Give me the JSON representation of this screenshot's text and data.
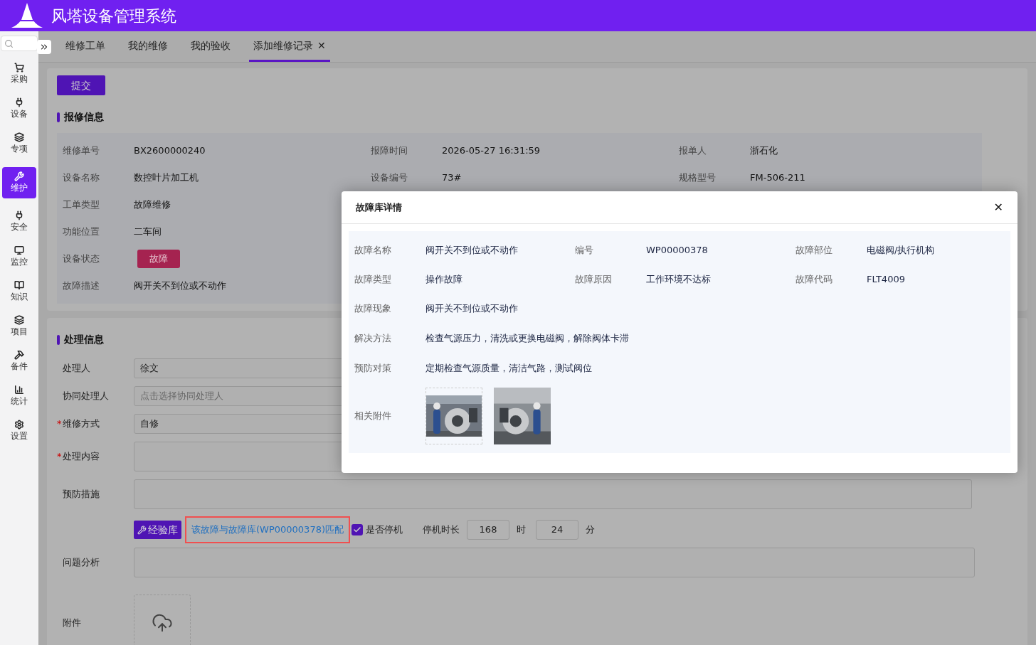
{
  "header": {
    "title": "风塔设备管理系统"
  },
  "tabs": [
    {
      "label": "维修工单",
      "selected": false
    },
    {
      "label": "我的维修",
      "selected": false
    },
    {
      "label": "我的验收",
      "selected": false
    },
    {
      "label": "添加维修记录",
      "selected": true,
      "close": "✕"
    }
  ],
  "sidebar": {
    "items": [
      {
        "label": "采购",
        "selected": false
      },
      {
        "label": "设备",
        "selected": false
      },
      {
        "label": "专项",
        "selected": false
      },
      {
        "label": "维护",
        "selected": true
      },
      {
        "label": "安全",
        "selected": false
      },
      {
        "label": "监控",
        "selected": false
      },
      {
        "label": "知识",
        "selected": false
      },
      {
        "label": "项目",
        "selected": false
      },
      {
        "label": "备件",
        "selected": false
      },
      {
        "label": "统计",
        "selected": false
      },
      {
        "label": "设置",
        "selected": false
      }
    ]
  },
  "submit_button": "提交",
  "repair_info": {
    "title": "报修信息",
    "rows": [
      [
        {
          "label": "维修单号",
          "value": "BX2600000240"
        },
        {
          "label": "报障时间",
          "value": "2026-05-27 16:31:59"
        },
        {
          "label": "报单人",
          "value": "浙石化"
        }
      ],
      [
        {
          "label": "设备名称",
          "value": "数控叶片加工机"
        },
        {
          "label": "设备编号",
          "value": "73#"
        },
        {
          "label": "规格型号",
          "value": "FM-506-211"
        }
      ],
      [
        {
          "label": "工单类型",
          "value": "故障维修"
        }
      ],
      [
        {
          "label": "功能位置",
          "value": "二车间"
        }
      ],
      [
        {
          "label": "设备状态",
          "value": "故障",
          "kind": "tag"
        }
      ],
      [
        {
          "label": "故障描述",
          "value": "阀开关不到位或不动作"
        }
      ]
    ]
  },
  "process_info": {
    "title": "处理信息",
    "fields": [
      {
        "label": "处理人",
        "kind": "input",
        "value": "徐文"
      },
      {
        "label": "协同处理人",
        "kind": "input",
        "placeholder": "点击选择协同处理人"
      },
      {
        "label": "维修方式",
        "kind": "input",
        "value": "自修",
        "required_mark": "*"
      },
      {
        "label": "处理内容",
        "kind": "textarea",
        "required_mark": "*"
      },
      {
        "label": "预防措施",
        "kind": "textarea"
      }
    ],
    "experience_button": "经验库",
    "match_link": "该故障与故障库(WP00000378)匹配",
    "shutdown": {
      "label": "是否停机",
      "checked": true
    },
    "duration": {
      "label": "停机时长",
      "hours": "168",
      "hours_unit": "时",
      "minutes": "24",
      "minutes_unit": "分"
    },
    "analysis": {
      "label": "问题分析"
    },
    "attachment": {
      "label": "附件"
    }
  },
  "modal": {
    "title": "故障库详情",
    "close": "✕",
    "fields": [
      {
        "label": "故障名称",
        "value": "阀开关不到位或不动作"
      },
      {
        "label": "编号",
        "value": "WP00000378"
      },
      {
        "label": "故障部位",
        "value": "电磁阀/执行机构"
      },
      {
        "label": "故障类型",
        "value": "操作故障"
      },
      {
        "label": "故障原因",
        "value": "工作环境不达标"
      },
      {
        "label": "故障代码",
        "value": "FLT4009"
      }
    ],
    "wide_fields": [
      {
        "label": "故障现象",
        "value": "阀开关不到位或不动作"
      },
      {
        "label": "解决方法",
        "value": "检查气源压力，清洗或更换电磁阀，解除阀体卡滞"
      },
      {
        "label": "预防对策",
        "value": "定期检查气源质量，清洁气路，测试阀位"
      }
    ],
    "attachments_label": "相关附件",
    "attachments": [
      {
        "kind": "picture",
        "bordered": true
      },
      {
        "kind": "picture",
        "bordered": false
      }
    ]
  }
}
